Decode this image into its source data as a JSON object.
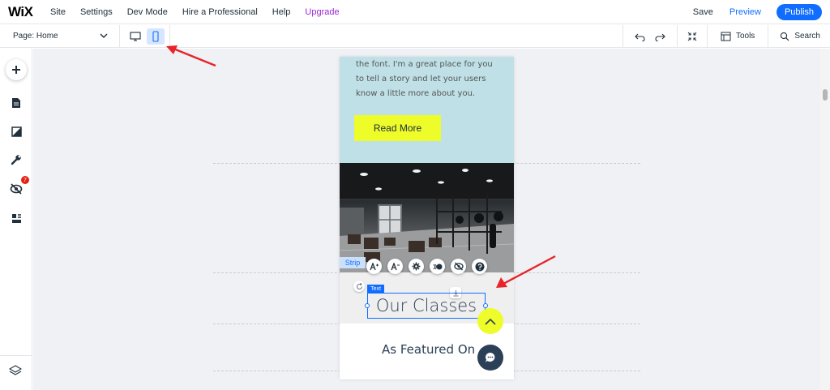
{
  "header": {
    "logo": "WiX",
    "menu": [
      "Site",
      "Settings",
      "Dev Mode",
      "Hire a Professional",
      "Help",
      "Upgrade"
    ],
    "save": "Save",
    "preview": "Preview",
    "publish": "Publish"
  },
  "subbar": {
    "page": "Page: Home",
    "tools": "Tools",
    "search": "Search"
  },
  "sidebar": {
    "badge_count": "7"
  },
  "mobile": {
    "paragraph": "the font. I'm a great place for you to tell a story and let your users know a little more about you.",
    "read_more": "Read More",
    "strip_tag": "Strip",
    "text_tag": "Text",
    "title": "Our Classes",
    "featured": "As Featured On"
  },
  "colors": {
    "accent": "#116dff",
    "upgrade": "#9a27d5",
    "button_yellow": "#eefc2a",
    "section_teal": "#bfe0e6",
    "arrow_red": "#e8232a"
  },
  "icons": [
    "desktop-icon",
    "mobile-icon",
    "undo-icon",
    "redo-icon",
    "zoom-out-icon",
    "tools-icon",
    "search-icon",
    "plus-icon",
    "pages-icon",
    "design-icon",
    "wrench-icon",
    "hidden-eye-icon",
    "sections-icon",
    "layers-icon",
    "font-increase-icon",
    "font-decrease-icon",
    "settings-icon",
    "animation-icon",
    "hide-icon",
    "help-icon",
    "chat-icon"
  ]
}
